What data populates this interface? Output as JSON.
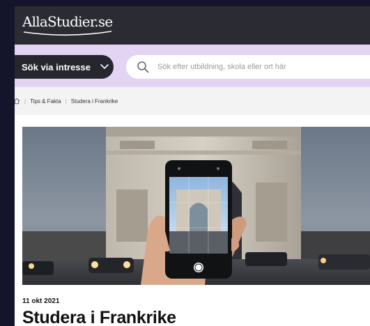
{
  "header": {
    "logo_text": "AllaStudier.se"
  },
  "search": {
    "interest_label": "Sök via intresse",
    "placeholder": "Sök efter utbildning, skola eller ort här"
  },
  "breadcrumb": {
    "items": [
      "Tips & Fakta",
      "Studera i Frankrike"
    ]
  },
  "article": {
    "date": "11 okt 2021",
    "title": "Studera i Frankrike"
  },
  "colors": {
    "header_bg": "#2b2c33",
    "search_band_bg": "#e2d4f2",
    "interest_button_bg": "#26272e",
    "breadcrumb_bg": "#f3f3f3"
  },
  "icons": [
    "logo-swoosh-icon",
    "chevron-down-icon",
    "search-icon",
    "home-icon"
  ]
}
